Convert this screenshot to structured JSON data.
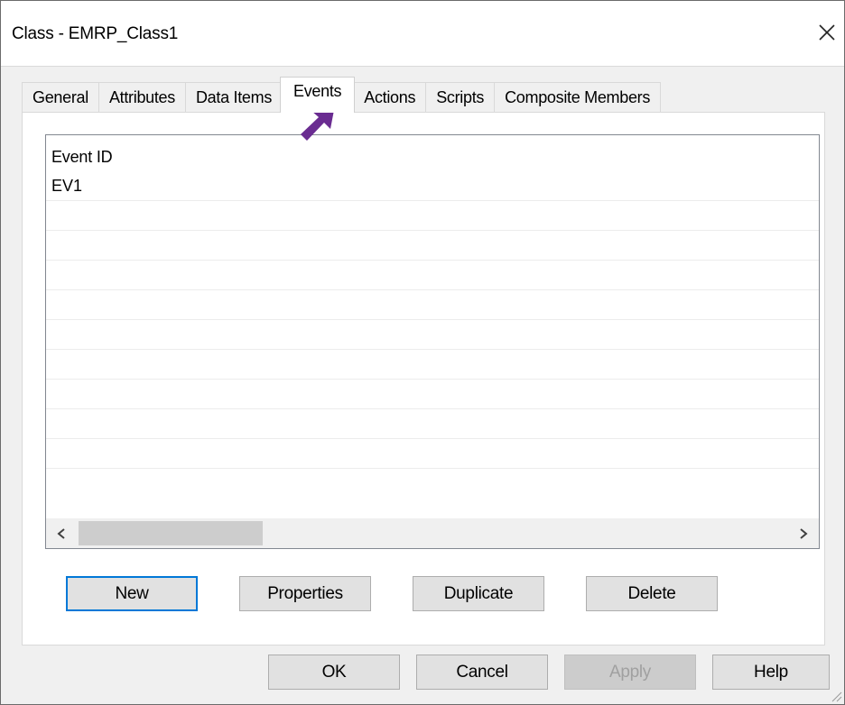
{
  "window": {
    "title": "Class - EMRP_Class1"
  },
  "tabs": [
    {
      "label": "General"
    },
    {
      "label": "Attributes"
    },
    {
      "label": "Data Items"
    },
    {
      "label": "Events"
    },
    {
      "label": "Actions"
    },
    {
      "label": "Scripts"
    },
    {
      "label": "Composite Members"
    }
  ],
  "active_tab": "Events",
  "events_list": {
    "column_header": "Event ID",
    "rows": [
      "EV1",
      "",
      "",
      "",
      "",
      "",
      "",
      "",
      "",
      ""
    ]
  },
  "panel_buttons": {
    "new": "New",
    "properties": "Properties",
    "duplicate": "Duplicate",
    "delete": "Delete"
  },
  "dialog_buttons": {
    "ok": "OK",
    "cancel": "Cancel",
    "apply": "Apply",
    "help": "Help"
  },
  "icons": {
    "close": "close-icon",
    "arrow": "arrow-pointer-icon",
    "scroll_left": "chevron-left-icon",
    "scroll_right": "chevron-right-icon"
  },
  "colors": {
    "annotation_arrow": "#6a2c91",
    "default_button_border": "#0078d7"
  }
}
